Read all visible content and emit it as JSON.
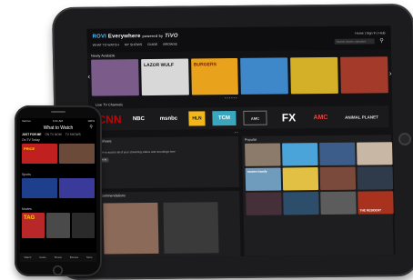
{
  "tablet": {
    "logo_brand": "ROVI",
    "logo_text": "Everywhere",
    "logo_powered": "powered by",
    "logo_tivo": "TiVO",
    "top_links": "Home | Sign In | Help",
    "nav": [
      "WHAT TO WATCH",
      "MY SHOWS",
      "GUIDE",
      "BROWSE"
    ],
    "search_placeholder": "Search shows, episodes",
    "newly_available_label": "Newly Available",
    "posters": [
      {
        "title": "",
        "color": "#7a5b8a"
      },
      {
        "title": "LAZOR WULF",
        "color": "#d8d8d8"
      },
      {
        "title": "BURGERS",
        "color": "#e9a21c"
      },
      {
        "title": "",
        "color": "#3e87c9"
      },
      {
        "title": "",
        "color": "#d4b028"
      },
      {
        "title": "",
        "color": "#a33a2a"
      }
    ],
    "live_label": "Live TV Channels",
    "channels": [
      {
        "name": "CNN",
        "color": "#cc0000"
      },
      {
        "name": "NBC",
        "color": "#ffffff"
      },
      {
        "name": "msnbc",
        "color": "#ffffff"
      },
      {
        "name": "HLN",
        "color": "#f3b719"
      },
      {
        "name": "TCM",
        "color": "#79d4e6"
      },
      {
        "name": "AMC",
        "color": "#bbbbbb"
      },
      {
        "name": "FX",
        "color": "#ffffff"
      },
      {
        "name": "AMC",
        "color": "#e64545"
      },
      {
        "name": "ANIMAL PLANET",
        "color": "#dddddd"
      }
    ],
    "my_shows": {
      "title": "My Shows",
      "text": "Sign in to access all of your streaming videos and recordings here",
      "button": "Sign In"
    },
    "recommendations_label": "Recommendations",
    "popular": {
      "label": "Popular",
      "tiles": [
        {
          "title": "",
          "color": "#8c7a6b"
        },
        {
          "title": "",
          "color": "#4aa3d9"
        },
        {
          "title": "",
          "color": "#3c5d8a"
        },
        {
          "title": "",
          "color": "#c9b7a6"
        },
        {
          "title": "modern family",
          "color": "#6f9bbd"
        },
        {
          "title": "",
          "color": "#e2c043"
        },
        {
          "title": "",
          "color": "#7a4b3d"
        },
        {
          "title": "",
          "color": "#2f3a4a"
        },
        {
          "title": "",
          "color": "#45303a"
        },
        {
          "title": "",
          "color": "#2d4e6a"
        },
        {
          "title": "",
          "color": "#5c5c5c"
        },
        {
          "title": "THE RESIDENT",
          "color": "#a8321e"
        }
      ]
    }
  },
  "phone": {
    "carrier": "Verizon",
    "time": "9:41 AM",
    "battery": "100%",
    "title": "What to Watch",
    "tabs": [
      "JUST FOR ME",
      "ON TV NOW",
      "TV SHOWS",
      "MOVIES"
    ],
    "section1": "On TV Today",
    "row1": [
      {
        "title": "PRICE",
        "color": "#c02020"
      },
      {
        "title": "",
        "color": "#6b4a3a"
      }
    ],
    "section2": "Sports",
    "row2": [
      {
        "title": "",
        "color": "#1d3f8c"
      },
      {
        "title": "",
        "color": "#3a3a9a"
      }
    ],
    "section3": "Movies",
    "row3": [
      {
        "title": "TAG",
        "color": "#b82828"
      },
      {
        "title": "",
        "color": "#4a4a4a"
      },
      {
        "title": "",
        "color": "#2a2a2a"
      }
    ],
    "tabbar": [
      "Watch",
      "Guide",
      "Shows",
      "Browse",
      "More"
    ]
  }
}
